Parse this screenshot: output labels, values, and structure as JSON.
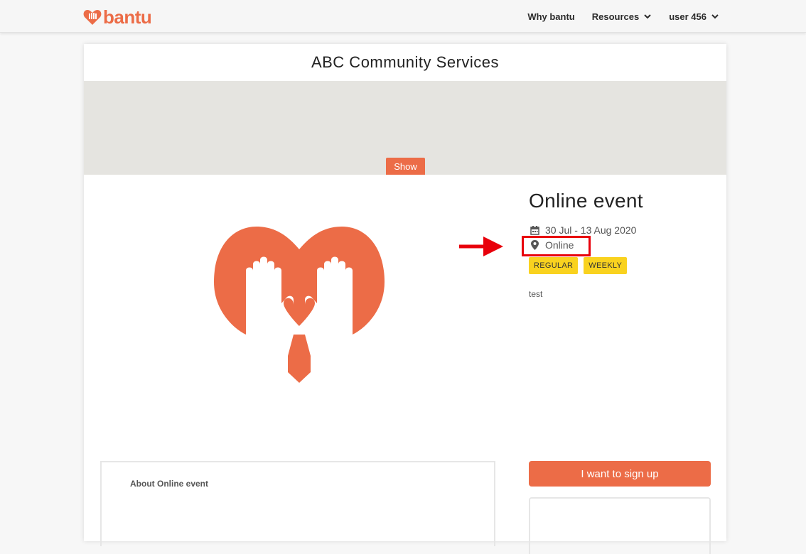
{
  "header": {
    "logo_text": "bantu",
    "nav": [
      {
        "label": "Why bantu",
        "has_dropdown": false
      },
      {
        "label": "Resources",
        "has_dropdown": true
      },
      {
        "label": "user 456",
        "has_dropdown": true
      }
    ]
  },
  "organization": {
    "name": "ABC Community Services"
  },
  "banner": {
    "show_label": "Show"
  },
  "event": {
    "title": "Online event",
    "date_range": "30 Jul - 13 Aug 2020",
    "location": "Online",
    "tags": [
      "REGULAR",
      "WEEKLY"
    ],
    "description": "test"
  },
  "about": {
    "title": "About Online event"
  },
  "actions": {
    "signup_label": "I want to sign up"
  },
  "colors": {
    "brand": "#ec6c47",
    "tag": "#f9d21f",
    "annotation": "#e8000b"
  },
  "icons": [
    "bantu-logo-icon",
    "chevron-down-icon",
    "calendar-icon",
    "map-pin-icon",
    "arrow-right-icon"
  ]
}
